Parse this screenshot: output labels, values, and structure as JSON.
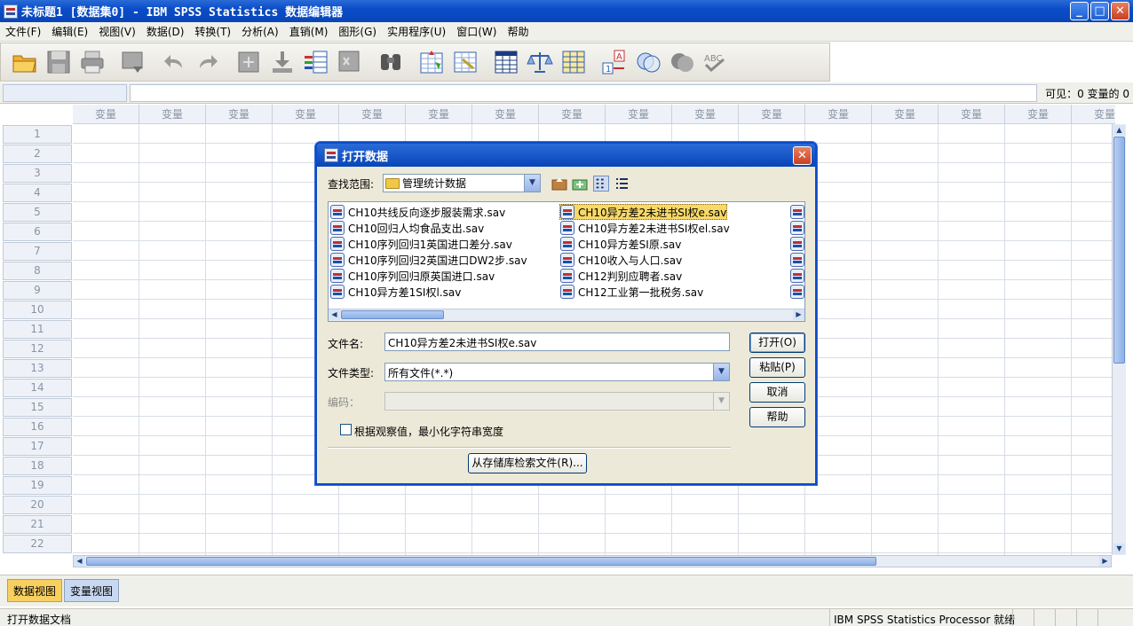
{
  "window": {
    "title": "未标题1 [数据集0] - IBM SPSS Statistics 数据编辑器",
    "minimize": "_",
    "maximize": "□",
    "close": "✕"
  },
  "menu": [
    "文件(F)",
    "编辑(E)",
    "视图(V)",
    "数据(D)",
    "转换(T)",
    "分析(A)",
    "直销(M)",
    "图形(G)",
    "实用程序(U)",
    "窗口(W)",
    "帮助"
  ],
  "toolbar": [
    "open-icon",
    "save-icon",
    "print-icon",
    "dialog-recall-icon",
    "undo-icon",
    "redo-icon",
    "goto-case-icon",
    "goto-variable-icon",
    "variables-icon",
    "run-descriptives-icon",
    "find-icon",
    "insert-cases-icon",
    "insert-variable-icon",
    "split-file-icon",
    "weight-cases-icon",
    "select-cases-icon",
    "value-labels-icon",
    "use-sets-icon",
    "show-all-variables-icon",
    "spell-check-icon"
  ],
  "cellbar": {
    "visible": "可见：0 变量的 0"
  },
  "grid": {
    "column_header": "变量",
    "rows": [
      "1",
      "2",
      "3",
      "4",
      "5",
      "6",
      "7",
      "8",
      "9",
      "10",
      "11",
      "12",
      "13",
      "14",
      "15",
      "16",
      "17",
      "18",
      "19",
      "20",
      "21",
      "22"
    ]
  },
  "tabs": {
    "data_view": "数据视图",
    "variable_view": "变量视图"
  },
  "status": {
    "left": "打开数据文档",
    "right": "IBM SPSS Statistics Processor 就绪"
  },
  "dialog": {
    "title": "打开数据",
    "close": "✕",
    "lookin_label": "查找范围:",
    "lookin_value": "管理统计数据",
    "files_col1": [
      "CH10共线反向逐步服装需求.sav",
      "CH10回归人均食品支出.sav",
      "CH10序列回归1英国进口差分.sav",
      "CH10序列回归2英国进口DW2步.sav",
      "CH10序列回归原英国进口.sav",
      "CH10异方差1SI权l.sav"
    ],
    "files_col2": [
      "CH10异方差2未进书SI权e.sav",
      "CH10异方差2未进书SI权el.sav",
      "CH10异方差SI原.sav",
      "CH10收入与人口.sav",
      "CH12判别应聘者.sav",
      "CH12工业第一批税务.sav"
    ],
    "selected_file": "CH10异方差2未进书SI权e.sav",
    "filename_label": "文件名:",
    "filename_value": "CH10异方差2未进书SI权e.sav",
    "filetype_label": "文件类型:",
    "filetype_value": "所有文件(*.*)",
    "encoding_label": "编码：",
    "checkbox_label": "根据观察值，最小化字符串宽度",
    "btn_open": "打开(O)",
    "btn_paste": "粘贴(P)",
    "btn_cancel": "取消",
    "btn_help": "帮助",
    "btn_repository": "从存储库检索文件(R)..."
  }
}
